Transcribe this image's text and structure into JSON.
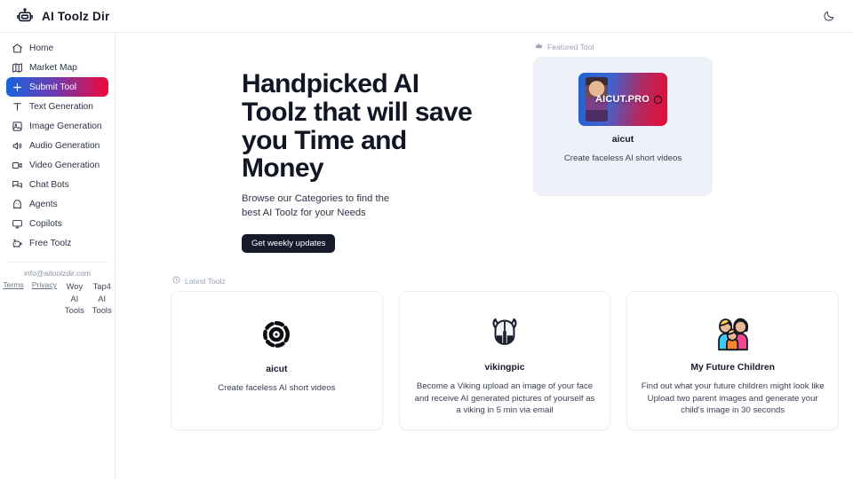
{
  "header": {
    "title": "AI Toolz Dir",
    "logo_icon": "robot-icon",
    "theme_toggle_icon": "moon-icon"
  },
  "sidebar": {
    "items": [
      {
        "label": "Home",
        "icon": "home-icon",
        "active": false
      },
      {
        "label": "Market Map",
        "icon": "map-icon",
        "active": false
      },
      {
        "label": "Submit Tool",
        "icon": "plus-icon",
        "active": true
      },
      {
        "label": "Text Generation",
        "icon": "text-icon",
        "active": false
      },
      {
        "label": "Image Generation",
        "icon": "image-icon",
        "active": false
      },
      {
        "label": "Audio Generation",
        "icon": "speaker-icon",
        "active": false
      },
      {
        "label": "Video Generation",
        "icon": "video-camera-icon",
        "active": false
      },
      {
        "label": "Chat Bots",
        "icon": "chat-bubbles-icon",
        "active": false
      },
      {
        "label": "Agents",
        "icon": "ghost-icon",
        "active": false
      },
      {
        "label": "Copilots",
        "icon": "monitor-icon",
        "active": false
      },
      {
        "label": "Free Toolz",
        "icon": "piggy-icon",
        "active": false
      }
    ],
    "footer": {
      "email": "info@aitoolzdir.com",
      "links": [
        "Terms",
        "Privacy"
      ],
      "partners": [
        "Woy AI Tools",
        "Tap4 AI Tools"
      ]
    }
  },
  "hero": {
    "title": "Handpicked AI Toolz that will save you Time and Money",
    "subtitle": "Browse our Categories to find the best AI Toolz for your Needs",
    "cta_label": "Get weekly updates"
  },
  "featured": {
    "section_label": "Featured Tool",
    "section_icon": "crown-icon",
    "thumb_text": "AICUT.PRO",
    "thumb_icon": "aperture-icon",
    "name": "aicut",
    "description": "Create faceless AI short videos"
  },
  "latest": {
    "section_label": "Latest Toolz",
    "section_icon": "clock-icon",
    "cards": [
      {
        "name": "aicut",
        "logo": "aperture-icon",
        "description": "Create faceless AI short videos"
      },
      {
        "name": "vikingpic",
        "logo": "viking-helmet-icon",
        "description": "Become a Viking upload an image of your face and receive AI generated pictures of yourself as a viking in 5 min via email"
      },
      {
        "name": "My Future Children",
        "logo": "family-emoji",
        "emoji": "👨‍👩‍👦",
        "description": "Find out what your future children might look like Upload two parent images and generate your child's image in 30 seconds"
      }
    ]
  },
  "colors": {
    "accent_start": "#1565e0",
    "accent_end": "#f0083a",
    "dark": "#161a2b",
    "featured_bg": "#eef1f7"
  }
}
